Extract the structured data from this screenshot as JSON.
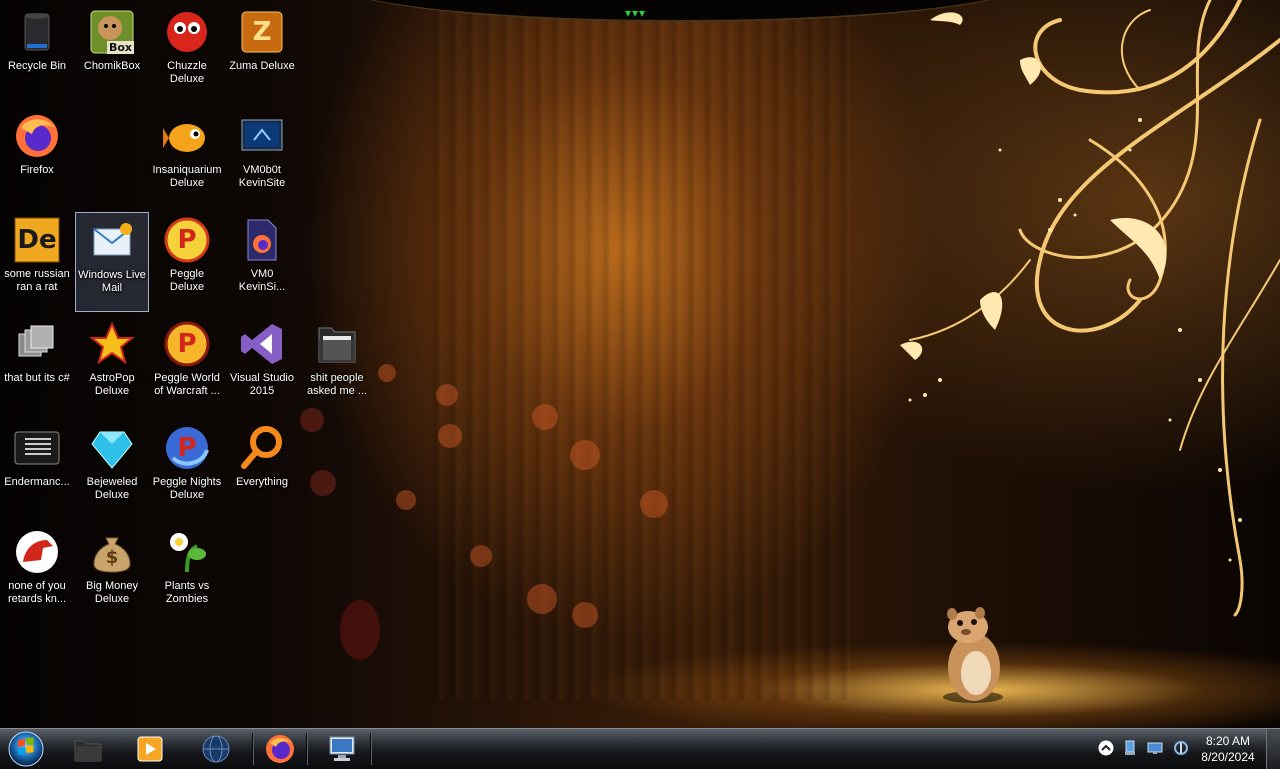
{
  "desktop": {
    "icons": [
      {
        "label": "Recycle Bin",
        "icon": "recycle-bin-icon"
      },
      {
        "label": "ChomikBox",
        "icon": "chomikbox-icon",
        "badge": "Box"
      },
      {
        "label": "Chuzzle\nDeluxe",
        "icon": "chuzzle-icon"
      },
      {
        "label": "Zuma Deluxe",
        "icon": "zuma-icon",
        "glyph": "Z"
      },
      {
        "label": "Firefox",
        "icon": "firefox-icon"
      },
      {
        "label": "Insaniquarium\nDeluxe",
        "icon": "insaniquarium-icon"
      },
      {
        "label": "VM0b0t\nKevinSite",
        "icon": "vm0b0t-icon"
      },
      {
        "label": "some russian\nran a rat",
        "icon": "de-icon",
        "glyph": "De"
      },
      {
        "label": "Windows Live\nMail",
        "icon": "windows-live-mail-icon"
      },
      {
        "label": "Peggle\nDeluxe",
        "icon": "peggle-icon",
        "glyph": "P"
      },
      {
        "label": "VM0\nKevinSi...",
        "icon": "firefox-file-icon"
      },
      {
        "label": "that but its c#",
        "icon": "windows-stack-icon"
      },
      {
        "label": "AstroPop\nDeluxe",
        "icon": "astropop-icon"
      },
      {
        "label": "Peggle World\nof Warcraft ...",
        "icon": "peggle-wow-icon",
        "glyph": "P"
      },
      {
        "label": "Visual Studio\n2015",
        "icon": "visual-studio-icon"
      },
      {
        "label": "shit people\nasked me ...",
        "icon": "folder-icon"
      },
      {
        "label": "Endermanc...",
        "icon": "endermanch-icon"
      },
      {
        "label": "Bejeweled\nDeluxe",
        "icon": "bejeweled-icon"
      },
      {
        "label": "Peggle Nights\nDeluxe",
        "icon": "peggle-nights-icon",
        "glyph": "P"
      },
      {
        "label": "Everything",
        "icon": "everything-search-icon"
      },
      {
        "label": "none of you\nretards kn...",
        "icon": "dino-icon"
      },
      {
        "label": "Big Money\nDeluxe",
        "icon": "money-bag-icon",
        "glyph": "$"
      },
      {
        "label": "Plants vs\nZombies",
        "icon": "plants-vs-zombies-icon"
      }
    ]
  },
  "taskbar": {
    "pinned": [
      {
        "name": "start-button",
        "icon": "windows-orb-icon"
      },
      {
        "name": "taskbar-folder",
        "icon": "folder-icon"
      },
      {
        "name": "taskbar-media-player",
        "icon": "media-player-icon"
      },
      {
        "name": "taskbar-globe",
        "icon": "globe-icon"
      },
      {
        "name": "taskbar-firefox",
        "icon": "firefox-icon"
      },
      {
        "name": "taskbar-remote-desktop",
        "icon": "remote-desktop-icon"
      }
    ],
    "tray_icons": [
      "show-hidden-icons-icon",
      "network-icon",
      "monitor-icon",
      "volume-icon"
    ],
    "clock": {
      "time": "8:20 AM",
      "date": "8/20/2024"
    }
  },
  "colors": {
    "desktop_dark": "#0a0503",
    "desktop_glow": "#c27a2a",
    "swirl_gold": "#ffd27a",
    "taskbar_dark": "#15171a"
  }
}
